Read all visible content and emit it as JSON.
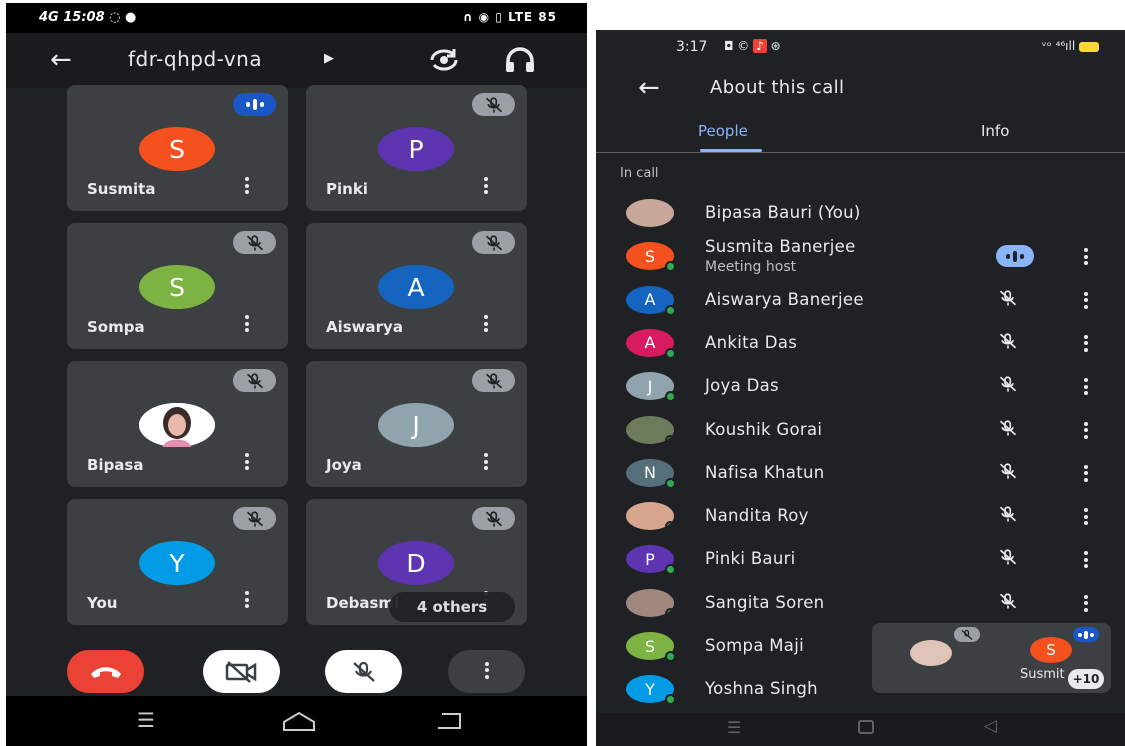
{
  "left": {
    "status": {
      "time": "15:08",
      "network": "4G",
      "icons_right": "LTE 85"
    },
    "meeting_code": "fdr-qhpd-vna",
    "tiles": [
      {
        "name": "Susmita",
        "initial": "S",
        "color": "#f4511e",
        "state": "speaking"
      },
      {
        "name": "Pinki",
        "initial": "P",
        "color": "#5e35b1",
        "state": "muted"
      },
      {
        "name": "Sompa",
        "initial": "S",
        "color": "#7cb342",
        "state": "muted"
      },
      {
        "name": "Aiswarya",
        "initial": "A",
        "color": "#1565c0",
        "state": "muted"
      },
      {
        "name": "Bipasa",
        "initial": "",
        "color": "#ffffff",
        "state": "muted"
      },
      {
        "name": "Joya",
        "initial": "J",
        "color": "#90a4ae",
        "state": "muted"
      },
      {
        "name": "You",
        "initial": "Y",
        "color": "#039be5",
        "state": "muted"
      },
      {
        "name": "Debasmi",
        "initial": "D",
        "color": "#5e35b1",
        "state": "muted"
      }
    ],
    "others_badge": "4 others",
    "colors": {
      "end_call": "#ea4335",
      "tile_bg": "#3c4043",
      "speaking": "#1a56c6"
    }
  },
  "right": {
    "status": {
      "time": "3:17"
    },
    "title": "About this call",
    "tabs": [
      "People",
      "Info"
    ],
    "section_label": "In call",
    "people": [
      {
        "name": "Bipasa Bauri (You)",
        "initial": "",
        "color": "#c8a89a",
        "sub": "",
        "mic": "none",
        "photo": true
      },
      {
        "name": "Susmita Banerjee",
        "initial": "S",
        "color": "#f4511e",
        "sub": "Meeting host",
        "mic": "speaking"
      },
      {
        "name": "Aiswarya Banerjee",
        "initial": "A",
        "color": "#1565c0",
        "sub": "",
        "mic": "muted"
      },
      {
        "name": "Ankita Das",
        "initial": "A",
        "color": "#d81b60",
        "sub": "",
        "mic": "muted"
      },
      {
        "name": "Joya Das",
        "initial": "J",
        "color": "#90a4ae",
        "sub": "",
        "mic": "muted"
      },
      {
        "name": "Koushik Gorai",
        "initial": "",
        "color": "#6d7b5a",
        "sub": "",
        "mic": "muted",
        "photo": true
      },
      {
        "name": "Nafisa Khatun",
        "initial": "N",
        "color": "#546e7a",
        "sub": "",
        "mic": "muted"
      },
      {
        "name": "Nandita Roy",
        "initial": "",
        "color": "#d7a48e",
        "sub": "",
        "mic": "muted",
        "photo": true
      },
      {
        "name": "Pinki Bauri",
        "initial": "P",
        "color": "#5e35b1",
        "sub": "",
        "mic": "muted"
      },
      {
        "name": "Sangita Soren",
        "initial": "",
        "color": "#a1887f",
        "sub": "",
        "mic": "muted",
        "photo": true
      },
      {
        "name": "Sompa Maji",
        "initial": "S",
        "color": "#7cb342",
        "sub": "",
        "mic": "none"
      },
      {
        "name": "Yoshna Singh",
        "initial": "Y",
        "color": "#039be5",
        "sub": "",
        "mic": "none"
      }
    ],
    "pip": {
      "name": "Susmit",
      "initial": "S",
      "count": "+10"
    },
    "colors": {
      "accent": "#8ab4f8"
    }
  }
}
